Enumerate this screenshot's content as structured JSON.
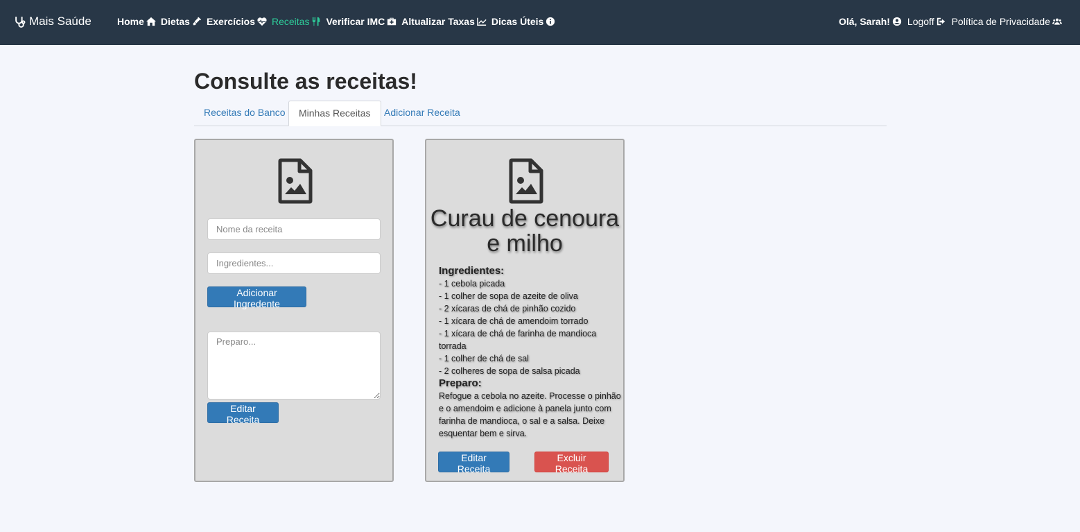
{
  "navbar": {
    "brand": "Mais Saúde",
    "left_items": [
      {
        "label": "Home",
        "icon": "home-icon"
      },
      {
        "label": "Dietas",
        "icon": "syringe-icon"
      },
      {
        "label": "Exercícios",
        "icon": "heartbeat-icon"
      },
      {
        "label": "Receitas",
        "icon": "utensils-icon",
        "active": true
      },
      {
        "label": "Verificar IMC",
        "icon": "medkit-icon"
      },
      {
        "label": "Altualizar Taxas",
        "icon": "chart-line-icon"
      },
      {
        "label": "Dicas Úteis",
        "icon": "info-circle-icon"
      }
    ],
    "greeting": "Olá, Sarah!",
    "logoff": "Logoff",
    "privacy": "Política de Privacidade",
    "active_color": "#2ecc9a",
    "background": "#283747"
  },
  "page": {
    "title": "Consulte as receitas!"
  },
  "tabs": [
    "Receitas do Banco",
    "Minhas Receitas",
    "Adicionar Receita"
  ],
  "form": {
    "name_placeholder": "Nome da receita",
    "ingredients_placeholder": "Ingredientes...",
    "add_ingredient": "Adicionar Ingredente",
    "prep_placeholder": "Preparo...",
    "edit": "Editar Receita"
  },
  "recipe": {
    "title": "Curau de cenoura e milho",
    "ingredients_heading": "Ingredientes:",
    "ingredients": [
      "- 1 cebola picada",
      "- 1 colher de sopa de azeite de oliva",
      "- 2 xícaras de chá de pinhão cozido",
      "- 1 xícara de chá de amendoim torrado",
      "- 1 xícara de chá de farinha de mandioca torrada",
      "- 1 colher de chá de sal",
      "- 2 colheres de sopa de salsa picada"
    ],
    "prep_heading": "Preparo:",
    "prep": "Refogue a cebola no azeite. Processe o pinhão e o amendoim e adicione à panela junto com farinha de mandioca, o sal e a salsa. Deixe esquentar bem e sirva.",
    "edit": "Editar Receita",
    "delete": "Excluir Receita"
  }
}
